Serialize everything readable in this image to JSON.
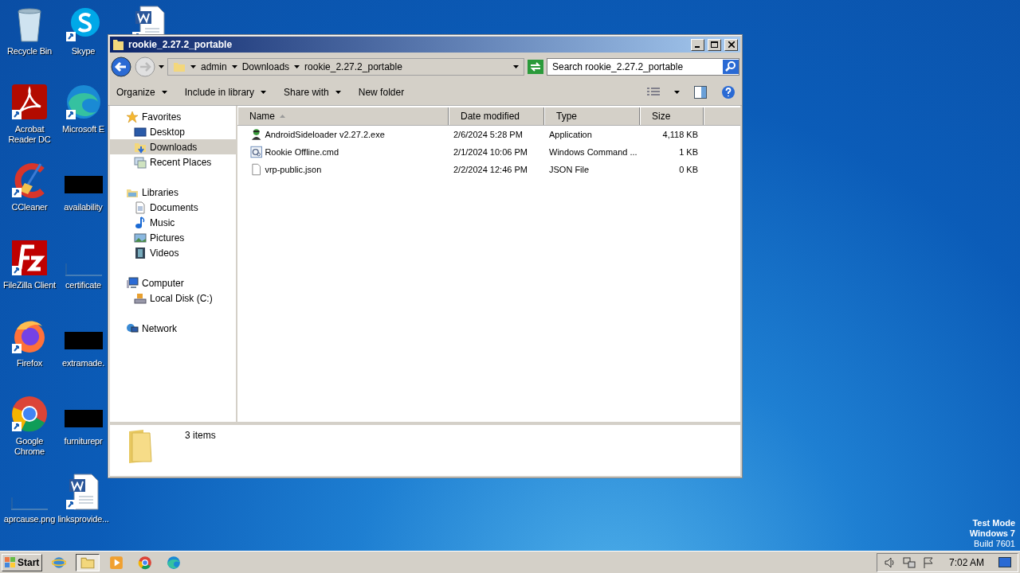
{
  "desktop_rows": [
    [
      {
        "label": "Recycle Bin",
        "kind": "recycle"
      },
      {
        "label": "Skype",
        "kind": "skype"
      },
      {
        "kind": "word"
      }
    ],
    [
      {
        "label": "Acrobat Reader DC",
        "kind": "acrobat"
      },
      {
        "label": "Microsoft E",
        "kind": "edge"
      }
    ],
    [
      {
        "label": "CCleaner",
        "kind": "ccleaner"
      },
      {
        "label": "availability",
        "kind": "redacted"
      }
    ],
    [
      {
        "label": "FileZilla Client",
        "kind": "filezilla"
      },
      {
        "label": "certificate",
        "kind": "thumb"
      }
    ],
    [
      {
        "label": "Firefox",
        "kind": "firefox"
      },
      {
        "label": "extramade.",
        "kind": "redacted"
      }
    ],
    [
      {
        "label": "Google Chrome",
        "kind": "chrome"
      },
      {
        "label": "furniturepr",
        "kind": "redacted"
      }
    ],
    [
      {
        "label": "aprcause.png",
        "kind": "thumb"
      },
      {
        "label": "linksprovide...",
        "kind": "word"
      }
    ]
  ],
  "window": {
    "title": "rookie_2.27.2_portable",
    "breadcrumb": [
      "admin",
      "Downloads",
      "rookie_2.27.2_portable"
    ],
    "search": {
      "placeholder": "Search rookie_2.27.2_portable"
    },
    "toolbar": [
      {
        "label": "Organize",
        "menu": true
      },
      {
        "label": "Include in library",
        "menu": true
      },
      {
        "label": "Share with",
        "menu": true
      },
      {
        "label": "New folder",
        "menu": false
      }
    ],
    "sidebar": [
      {
        "label": "Favorites",
        "kind": "star",
        "selected": false,
        "children": [
          {
            "label": "Desktop",
            "kind": "desktop",
            "selected": false
          },
          {
            "label": "Downloads",
            "kind": "downloads",
            "selected": true
          },
          {
            "label": "Recent Places",
            "kind": "recent",
            "selected": false
          }
        ]
      },
      {
        "label": "Libraries",
        "kind": "libraries",
        "selected": false,
        "children": [
          {
            "label": "Documents",
            "kind": "documents",
            "selected": false
          },
          {
            "label": "Music",
            "kind": "music",
            "selected": false
          },
          {
            "label": "Pictures",
            "kind": "pictures",
            "selected": false
          },
          {
            "label": "Videos",
            "kind": "videos",
            "selected": false
          }
        ]
      },
      {
        "label": "Computer",
        "kind": "computer",
        "selected": false,
        "children": [
          {
            "label": "Local Disk (C:)",
            "kind": "disk",
            "selected": false
          }
        ]
      },
      {
        "label": "Network",
        "kind": "network",
        "selected": false
      }
    ],
    "columns": [
      {
        "label": "Name",
        "sorted": true
      },
      {
        "label": "Date modified",
        "sorted": false
      },
      {
        "label": "Type",
        "sorted": false
      },
      {
        "label": "Size",
        "sorted": false
      }
    ],
    "files": [
      {
        "name": "AndroidSideloader v2.27.2.exe",
        "date": "2/6/2024 5:28 PM",
        "type": "Application",
        "size": "4,118 KB",
        "kind": "exe"
      },
      {
        "name": "Rookie Offline.cmd",
        "date": "2/1/2024 10:06 PM",
        "type": "Windows Command ...",
        "size": "1 KB",
        "kind": "cmd"
      },
      {
        "name": "vrp-public.json",
        "date": "2/2/2024 12:46 PM",
        "type": "JSON File",
        "size": "0 KB",
        "kind": "file"
      }
    ],
    "status": "3 items"
  },
  "taskbar": {
    "start": "Start",
    "apps": [
      {
        "kind": "ie",
        "selected": false
      },
      {
        "kind": "explorer",
        "selected": true
      },
      {
        "kind": "media",
        "selected": false
      },
      {
        "kind": "chrome",
        "selected": false
      },
      {
        "kind": "edge",
        "selected": false
      }
    ],
    "clock": "7:02 AM"
  },
  "os_notice": [
    "Test Mode",
    "Windows 7",
    "Build 7601"
  ]
}
